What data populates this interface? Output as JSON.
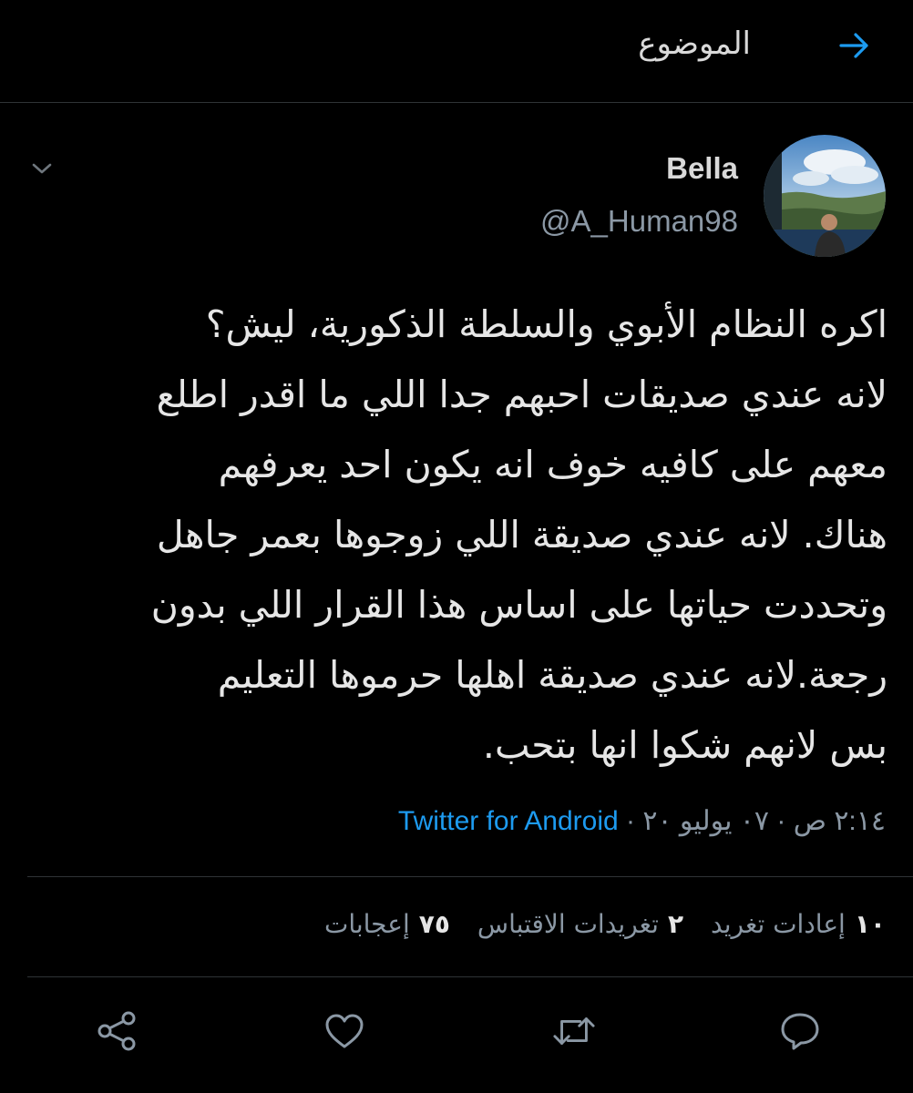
{
  "header": {
    "title": "الموضوع"
  },
  "tweet": {
    "display_name": "Bella",
    "handle": "@A_Human98",
    "lines": [
      "اكره النظام الأبوي والسلطة الذكورية، ليش؟",
      "لانه عندي صديقات احبهم جدا اللي ما اقدر اطلع",
      "معهم على كافيه خوف انه يكون احد يعرفهم",
      "هناك. لانه عندي صديقة اللي زوجوها بعمر جاهل",
      "وتحددت حياتها على اساس هذا القرار اللي بدون",
      "رجعة.لانه عندي صديقة اهلها حرموها التعليم",
      "بس لانهم شكوا انها بتحب."
    ],
    "timestamp": "٢:١٤ ص · ٠٧ يوليو ٢٠",
    "separator": " · ",
    "source": "Twitter for Android"
  },
  "stats": {
    "retweets": {
      "count": "١٠",
      "label": "إعادات تغريد"
    },
    "quotes": {
      "count": "٢",
      "label": "تغريدات الاقتباس"
    },
    "likes": {
      "count": "٧٥",
      "label": "إعجابات"
    }
  },
  "colors": {
    "background": "#000000",
    "accent": "#1d9bf0",
    "muted": "#8b98a5",
    "text": "#e6e6e6"
  },
  "icons": {
    "back": "arrow-right-icon",
    "more": "chevron-down-icon",
    "reply": "reply-icon",
    "retweet": "retweet-icon",
    "like": "heart-icon",
    "share": "share-icon"
  }
}
